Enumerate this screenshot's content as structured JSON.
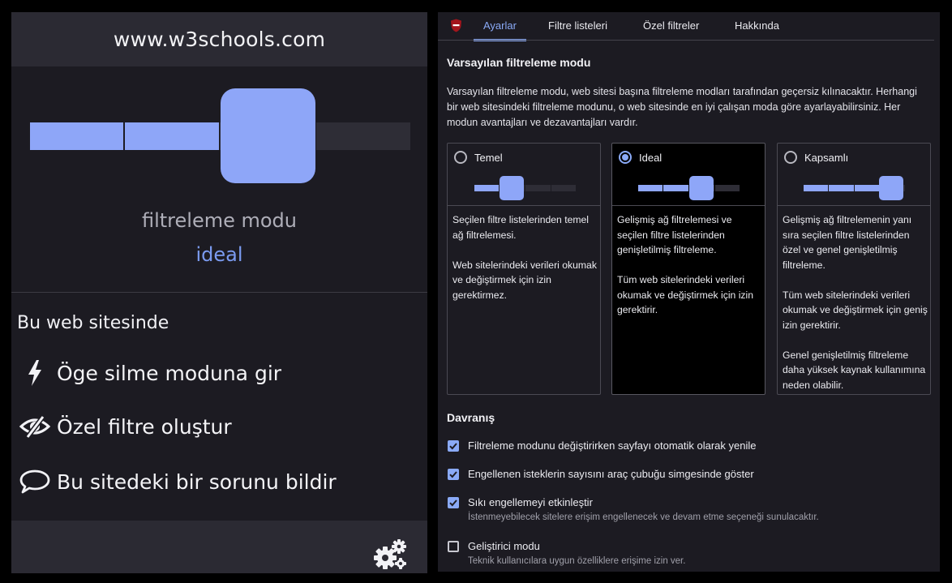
{
  "popup": {
    "hostname": "www.w3schools.com",
    "mode_label": "filtreleme modu",
    "mode_value": "ideal",
    "mode_level_index": 2,
    "mode_level_count": 4,
    "site_section_title": "Bu web sitesinde",
    "tools": [
      {
        "label": "Öge silme moduna gir",
        "icon": "lightning-bolt-icon"
      },
      {
        "label": "Özel filtre oluştur",
        "icon": "eye-slash-icon"
      },
      {
        "label": "Bu sitedeki bir sorunu bildir",
        "icon": "speech-bubble-icon"
      }
    ],
    "footer_icon": "gears-icon"
  },
  "settings": {
    "tabs": [
      {
        "label": "Ayarlar",
        "active": true
      },
      {
        "label": "Filtre listeleri",
        "active": false
      },
      {
        "label": "Özel filtreler",
        "active": false
      },
      {
        "label": "Hakkında",
        "active": false
      }
    ],
    "filtering_title": "Varsayılan filtreleme modu",
    "filtering_intro": "Varsayılan filtreleme modu, web sitesi başına filtreleme modları tarafından geçersiz kılınacaktır. Herhangi bir web sitesindeki filtreleme modunu, o web sitesinde en iyi çalışan moda göre ayarlayabilirsiniz. Her modun avantajları ve dezavantajları vardır.",
    "modes": [
      {
        "name": "Temel",
        "selected": false,
        "level_index": 1,
        "description": "Seçilen filtre listelerinden temel ağ filtrelemesi.\n\nWeb sitelerindeki verileri okumak ve değiştirmek için izin gerektirmez."
      },
      {
        "name": "Ideal",
        "selected": true,
        "level_index": 2,
        "description": "Gelişmiş ağ filtrelemesi ve seçilen filtre listelerinden genişletilmiş filtreleme.\n\nTüm web sitelerindeki verileri okumak ve değiştirmek için izin gerektirir."
      },
      {
        "name": "Kapsamlı",
        "selected": false,
        "level_index": 3,
        "description": "Gelişmiş ağ filtrelemenin yanı sıra seçilen filtre listelerinden özel ve genel genişletilmiş filtreleme.\n\nTüm web sitelerindeki verileri okumak ve değiştirmek için geniş izin gerektirir.\n\nGenel genişletilmiş filtreleme daha yüksek kaynak kullanımına neden olabilir."
      }
    ],
    "behavior_title": "Davranış",
    "options": [
      {
        "label": "Filtreleme modunu değiştirirken sayfayı otomatik olarak yenile",
        "checked": true,
        "sub": ""
      },
      {
        "label": "Engellenen isteklerin sayısını araç çubuğu simgesinde göster",
        "checked": true,
        "sub": ""
      },
      {
        "label": "Sıkı engellemeyi etkinleştir",
        "checked": true,
        "sub": "İstenmeyebilecek sitelere erişim engellenecek ve devam etme seçeneği sunulacaktır."
      },
      {
        "label": "Geliştirici modu",
        "checked": false,
        "sub": "Teknik kullanıcılara uygun özelliklere erişime izin ver."
      }
    ]
  },
  "colors": {
    "accent": "#8aaaf7",
    "knob": "#8ea6f8",
    "track_on": "#8ea6f8",
    "track_off": "#2e2d36",
    "panel_bg": "#1c1b22",
    "header_bg": "#2b2a33"
  }
}
